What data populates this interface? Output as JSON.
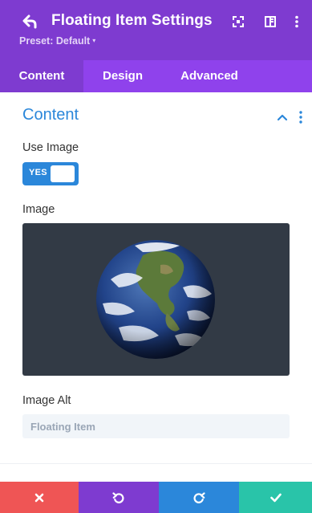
{
  "header": {
    "title": "Floating Item Settings",
    "preset_label": "Preset: Default",
    "preset_caret": "▾",
    "background": "#7e3bd0"
  },
  "tabs": [
    {
      "label": "Content",
      "active": true
    },
    {
      "label": "Design",
      "active": false
    },
    {
      "label": "Advanced",
      "active": false
    }
  ],
  "section": {
    "title": "Content",
    "expanded": true
  },
  "fields": {
    "use_image": {
      "label": "Use Image",
      "toggle_text": "YES",
      "value": true
    },
    "image": {
      "label": "Image",
      "content": "earth-globe-image"
    },
    "image_alt": {
      "label": "Image Alt",
      "value": "",
      "placeholder": "Floating Item"
    }
  },
  "footer": {
    "buttons": [
      {
        "name": "discard-button",
        "icon": "close-icon",
        "color": "#ef5555"
      },
      {
        "name": "undo-button",
        "icon": "undo-icon",
        "color": "#7e3bd0"
      },
      {
        "name": "redo-button",
        "icon": "redo-icon",
        "color": "#2b87da"
      },
      {
        "name": "save-button",
        "icon": "check-icon",
        "color": "#29c4a9"
      }
    ]
  },
  "colors": {
    "accent_blue": "#2b87da",
    "tab_bar": "#8f42ec",
    "image_background": "#323a45"
  }
}
